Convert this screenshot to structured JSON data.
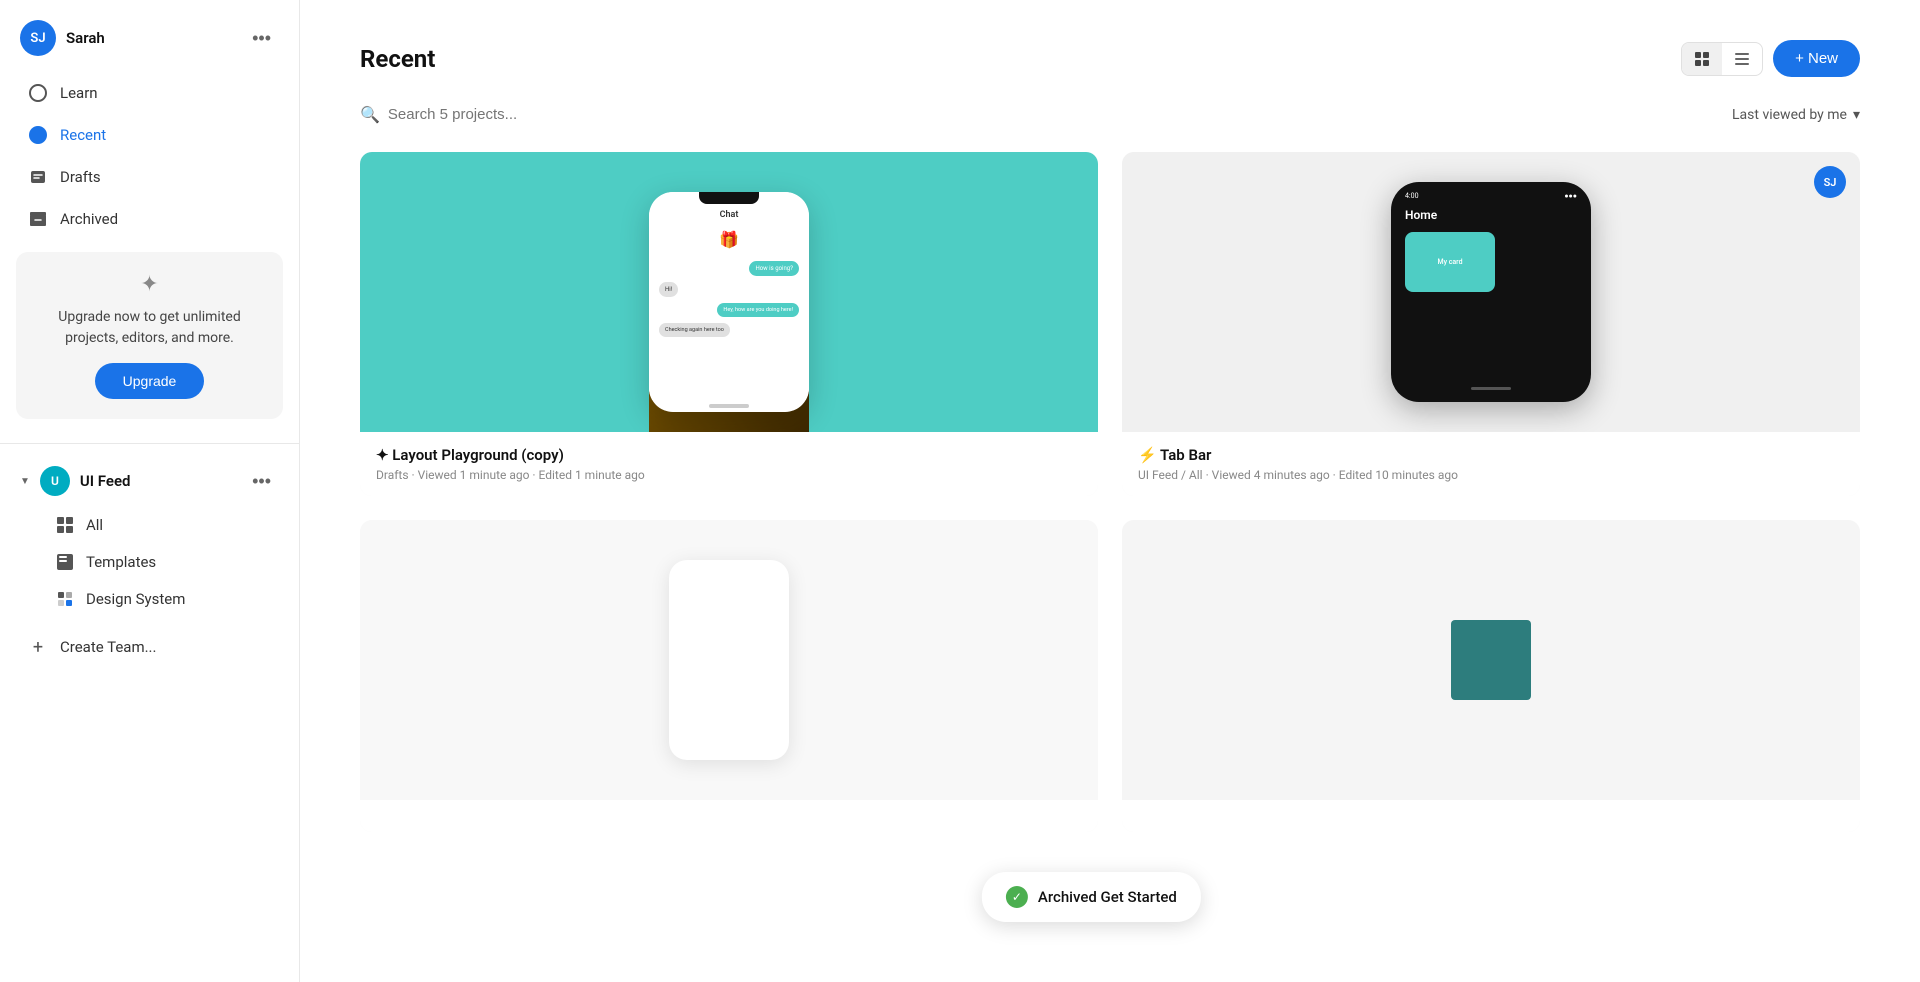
{
  "sidebar": {
    "user": {
      "name": "Sarah",
      "initials": "SJ",
      "avatar_color": "#1a73e8"
    },
    "nav_items": [
      {
        "id": "learn",
        "label": "Learn",
        "icon": "circle-outline",
        "active": false
      },
      {
        "id": "recent",
        "label": "Recent",
        "icon": "circle-filled",
        "active": true
      },
      {
        "id": "drafts",
        "label": "Drafts",
        "icon": "drafts",
        "active": false
      },
      {
        "id": "archived",
        "label": "Archived",
        "icon": "archive",
        "active": false
      }
    ],
    "upgrade": {
      "icon": "✦",
      "text": "Upgrade now to get unlimited projects, editors, and more.",
      "button_label": "Upgrade"
    },
    "team": {
      "name": "UI Feed",
      "initials": "U",
      "avatar_color": "#00acc1",
      "expanded": true,
      "items": [
        {
          "id": "all",
          "label": "All",
          "icon": "grid"
        },
        {
          "id": "templates",
          "label": "Templates",
          "icon": "pages"
        },
        {
          "id": "design-system",
          "label": "Design System",
          "icon": "pages"
        }
      ]
    },
    "create_team_label": "Create Team..."
  },
  "main": {
    "title": "Recent",
    "search": {
      "placeholder": "Search 5 projects...",
      "sort_label": "Last viewed by me"
    },
    "new_button": "+ New",
    "projects": [
      {
        "id": "layout-playground",
        "title": "✦ Layout Playground (copy)",
        "meta": "Drafts · Viewed 1 minute ago · Edited 1 minute ago",
        "preview_type": "chat-phone",
        "bg_color": "teal"
      },
      {
        "id": "tab-bar",
        "title": "⚡ Tab Bar",
        "meta": "UI Feed / All · Viewed 4 minutes ago · Edited 10 minutes ago",
        "preview_type": "dark-phone",
        "bg_color": "light-gray",
        "has_avatar": true,
        "avatar_initials": "SJ"
      },
      {
        "id": "project-3",
        "title": "",
        "meta": "",
        "preview_type": "white-phone",
        "bg_color": "light-gray"
      },
      {
        "id": "project-4",
        "title": "",
        "meta": "",
        "preview_type": "teal-square",
        "bg_color": "light-gray"
      }
    ],
    "toast": {
      "text": "Archived Get Started",
      "icon": "✓"
    }
  }
}
